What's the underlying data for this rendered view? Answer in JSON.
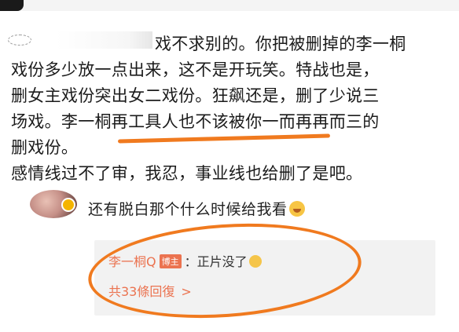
{
  "post": {
    "lines": [
      "戏不求别的。你把被删掉的李一桐",
      "戏份多少放一点出来，这不是开玩笑。特战也是，",
      "删女主戏份突出女二戏份。狂飙还是，删了少说三",
      "场戏。李一桐再工具人也不该被你一而再再而三的",
      "删戏份。",
      "感情线过不了审，我忍，事业线也给删了是吧。"
    ]
  },
  "reply": {
    "text": "还有脱白那个什么时候给我看",
    "emoji_icon": "grin-tears-emoji-icon"
  },
  "sub_reply": {
    "author": "李一桐Q",
    "badge": "博主",
    "text": "：正片没了",
    "emoji_icon": "sob-emoji-icon",
    "count_label": "共33條回復",
    "chevron": ">"
  },
  "colors": {
    "accent": "#eb7350",
    "markup_orange": "#f07a1f"
  }
}
